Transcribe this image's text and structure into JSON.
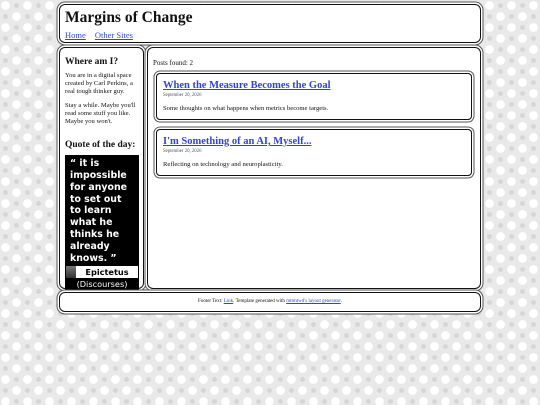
{
  "header": {
    "site_title": "Margins of Change",
    "nav": [
      {
        "label": "Home"
      },
      {
        "label": "Other Sites"
      }
    ]
  },
  "sidebar": {
    "about_heading": "Where am I?",
    "about_p1": "You are in a digital space created by Carl Perkins, a real tough thinker guy.",
    "about_p2": "Stay a while. Maybe you'll read some stuff you like. Maybe you won't.",
    "quote_heading": "Quote of the day:",
    "quote": {
      "text": "“ it is impossible for anyone to set out to learn what he thinks he already knows. ”",
      "author": "Epictetus",
      "source": "(Discourses)"
    }
  },
  "main": {
    "posts_found": "Posts found: 2",
    "posts": [
      {
        "title": "When the Measure Becomes the Goal",
        "date": "September 20, 2026",
        "summary": "Some thoughts on what happens when metrics become targets."
      },
      {
        "title": "I'm Something of an AI, Myself...",
        "date": "September 20, 2026",
        "summary": "Reflecting on technology and neuroplasticity."
      }
    ]
  },
  "footer": {
    "prefix": "Footer Text: ",
    "link_label": "Link",
    "middle": ". Template generated with ",
    "generator_label": "mttmtwd's layout generator",
    "suffix": "."
  }
}
